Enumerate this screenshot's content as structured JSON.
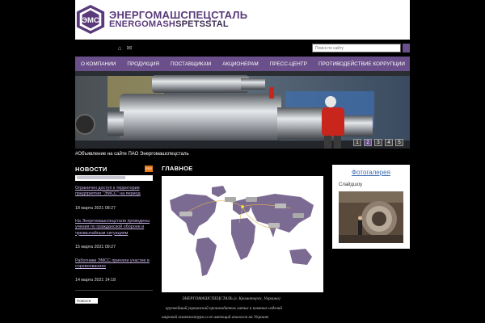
{
  "header": {
    "logo_ru": "ЭНЕРГОМАШСПЕЦСТАЛЬ",
    "logo_en_a": "ENERGOMASH",
    "logo_en_b": "SPETSSTAL"
  },
  "utility": {
    "search_placeholder": "Поиск по сайту"
  },
  "nav": {
    "items": [
      "О КОМПАНИИ",
      "ПРОДУКЦИЯ",
      "ПОСТАВЩИКАМ",
      "АКЦИОНЕРАМ",
      "ПРЕСС-ЦЕНТР",
      "ПРОТИВОДЕЙСТВИЕ КОРРУПЦИИ"
    ]
  },
  "hero": {
    "pages": [
      "1",
      "2",
      "3",
      "4",
      "5"
    ],
    "active_page": 1
  },
  "ticker": {
    "text": "#Объявление на сайте ПАО Энергомашспецсталь"
  },
  "news": {
    "heading": "НОВОСТИ",
    "rss": "RSS",
    "items": [
      {
        "title": "Ограничен доступ к территории предприятия \"ЭМСС\" на период",
        "date": "18 марта 2021 08:27"
      },
      {
        "title": "На Энергомашспецстали проведены учения по гражданской обороне и чрезвычайным ситуациям",
        "date": "15 марта 2021 09:27"
      },
      {
        "title": "Работники ЭМСС приняли участие в соревнованиях",
        "date": "14 марта 2021 14:18"
      }
    ],
    "badge2": "Новости"
  },
  "main": {
    "heading": "ГЛАВНОЕ",
    "caption_lines": [
      "ЭНЕРГОМАШСПЕЦСТАЛЬ (г. Краматорск, Украина)",
      "крупнейший украинский производитель литых и кованых изделий",
      "широкой номенклатуры и не имеющий аналогов на Украине"
    ]
  },
  "gallery": {
    "title": "Фотогалерея",
    "subtitle": "Слайдшоу"
  }
}
